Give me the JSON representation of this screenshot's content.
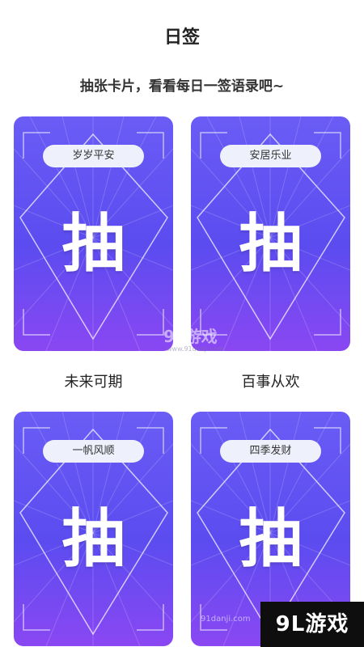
{
  "header": {
    "title": "日签",
    "subtitle": "抽张卡片，看看每日一签语录吧~"
  },
  "cards": [
    {
      "tag": "岁岁平安",
      "action": "抽",
      "caption": "未来可期"
    },
    {
      "tag": "安居乐业",
      "action": "抽",
      "caption": "百事从欢"
    },
    {
      "tag": "一帆风顺",
      "action": "抽"
    },
    {
      "tag": "四季发财",
      "action": "抽"
    }
  ],
  "watermark": {
    "center_text": "9L游戏",
    "center_url": "www.91danji.com",
    "corner_text": "9L游戏",
    "corner_url": "91danji.com"
  },
  "colors": {
    "card_top": "#6a5cf5",
    "card_bottom": "#8a47f2",
    "pill_bg": "#eef0fb"
  }
}
